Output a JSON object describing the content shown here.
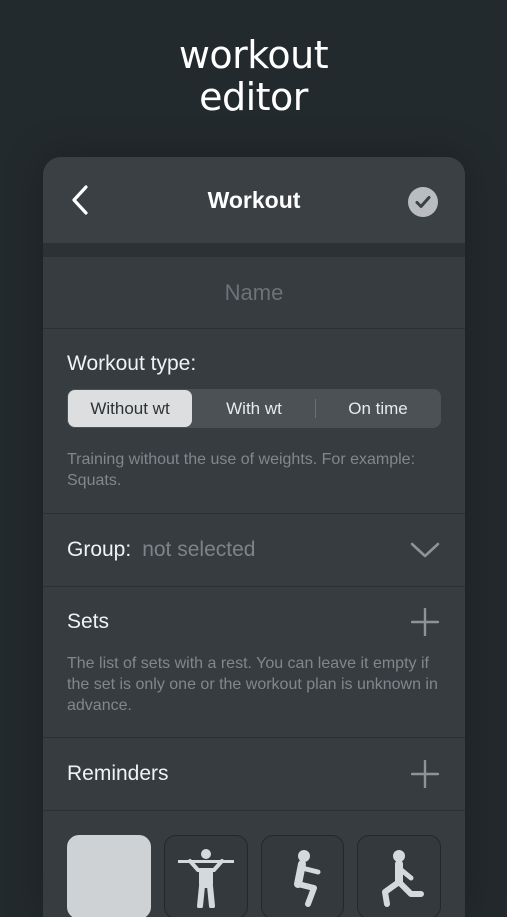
{
  "promo": {
    "title_line1": "workout",
    "title_line2": "editor"
  },
  "navbar": {
    "title": "Workout",
    "back_icon": "chevron-left-icon",
    "confirm_icon": "checkmark-circle-icon"
  },
  "name_field": {
    "placeholder": "Name",
    "value": ""
  },
  "workout_type": {
    "label": "Workout type:",
    "options": [
      "Without wt",
      "With wt",
      "On time"
    ],
    "selected": "Without wt",
    "description": "Training without the use of weights. For example: Squats."
  },
  "group": {
    "label": "Group:",
    "value": "not selected",
    "icon": "chevron-down-icon"
  },
  "sets": {
    "label": "Sets",
    "add_icon": "plus-icon",
    "description": "The list of sets with a rest. You can leave it empty if the set is only one or the workout plan is unknown in advance."
  },
  "reminders": {
    "label": "Reminders",
    "add_icon": "plus-icon"
  },
  "exercise_icons": [
    "blank-icon",
    "pull-up-icon",
    "squat-icon",
    "lunge-icon"
  ],
  "colors": {
    "background": "#232a2e",
    "card": "#363c40",
    "accent_light": "#dcdedf"
  }
}
